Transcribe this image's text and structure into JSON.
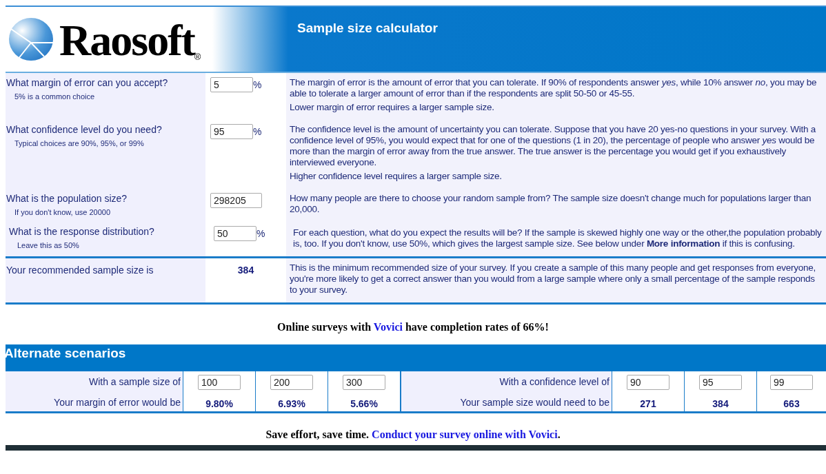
{
  "header": {
    "logo": "Raosoft",
    "registered": "®",
    "title": "Sample size calculator"
  },
  "questions": [
    {
      "label": "What margin of error can you accept?",
      "hint": "5% is a common choice",
      "value": "5",
      "unit": "%",
      "paragraphs": [
        "The margin of error is the amount of error that you can tolerate. If 90% of respondents answer *yes*, while 10% answer *no*, you may be able to tolerate a larger amount of error than if the respondents are split 50-50 or 45-55.",
        "Lower margin of error requires a larger sample size."
      ]
    },
    {
      "label": "What confidence level do you need?",
      "hint": "Typical choices are 90%, 95%, or 99%",
      "value": "95",
      "unit": "%",
      "paragraphs": [
        "The confidence level is the amount of uncertainty you can tolerate. Suppose that you have 20 yes-no questions in your survey. With a confidence level of 95%, you would expect that for one of the questions (1 in 20), the percentage of people who answer *yes* would be more than the margin of error away from the true answer. The true answer is the percentage you would get if you exhaustively interviewed everyone.",
        "Higher confidence level requires a larger sample size."
      ]
    },
    {
      "label": "What is the population size?",
      "hint": "If you don't know, use 20000",
      "value": "298205",
      "paragraphs": [
        "How many people are there to choose your random sample from? The sample size doesn't change much for populations larger than 20,000."
      ]
    },
    {
      "label": "What is the response distribution?",
      "hint": "Leave this as 50%",
      "value": "50",
      "unit": "%",
      "paragraphs": [
        "For each question, what do you expect the results will be? If the sample is skewed highly one way or the other,the population probably is, too. If you don't know, use 50%, which gives the largest sample size. See below under **More information** if this is confusing."
      ]
    }
  ],
  "result": {
    "label": "Your recommended sample size is",
    "value": "384",
    "paragraph": "This is the minimum recommended size of your survey. If you create a sample of this many people and get responses from everyone, you're more likely to get a correct answer than you would from a large sample where only a small percentage of the sample responds to your survey."
  },
  "promo": {
    "before": "Online surveys with ",
    "link": "Vovici",
    "after": " have completion rates of 66%!"
  },
  "alternate": {
    "title": "Alternate scenarios",
    "groups": [
      {
        "input_label": "With a sample size of",
        "output_label": "Your margin of error would be",
        "inputs": [
          "100",
          "200",
          "300"
        ],
        "outputs": [
          "9.80%",
          "6.93%",
          "5.66%"
        ]
      },
      {
        "input_label": "With a confidence level of",
        "output_label": "Your sample size would need to be",
        "inputs": [
          "90",
          "95",
          "99"
        ],
        "outputs": [
          "271",
          "384",
          "663"
        ]
      }
    ]
  },
  "footer": {
    "before": "Save effort, save time. ",
    "link": "Conduct your survey online with Vovici",
    "after": "."
  }
}
